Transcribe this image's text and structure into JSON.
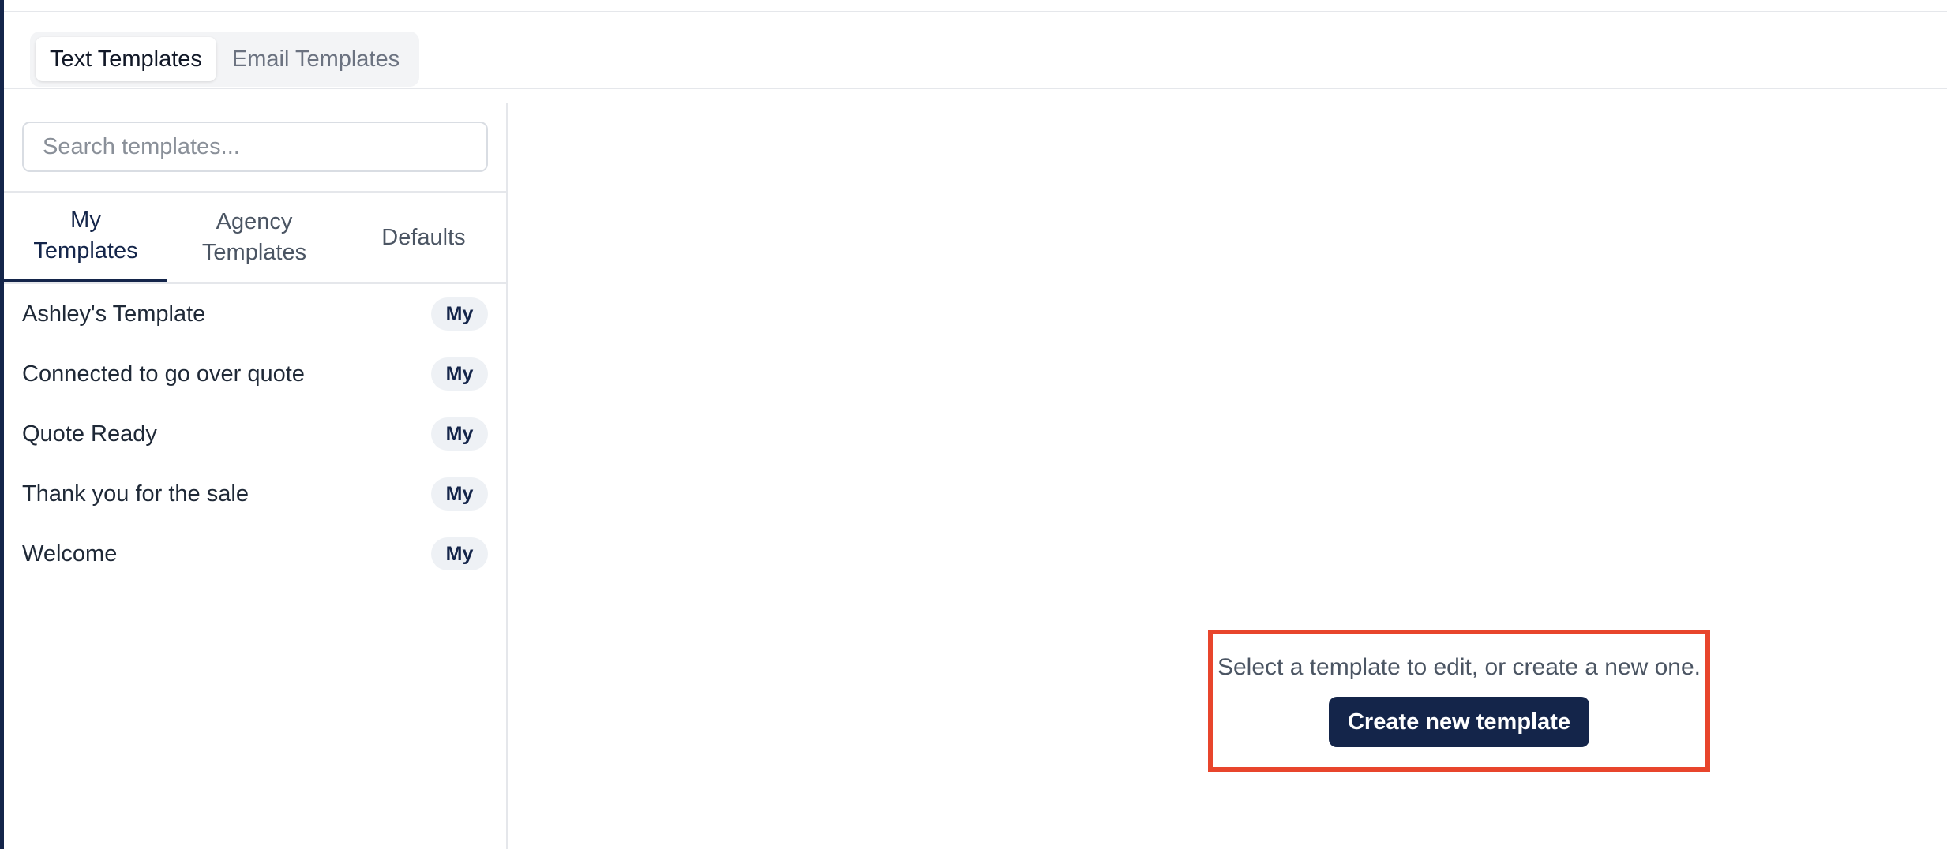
{
  "template_types": {
    "tabs": [
      {
        "label": "Text Templates",
        "active": true
      },
      {
        "label": "Email Templates",
        "active": false
      }
    ]
  },
  "search": {
    "placeholder": "Search templates...",
    "value": ""
  },
  "scope_tabs": {
    "my": {
      "line1": "My",
      "line2": "Templates",
      "active": true
    },
    "agency": {
      "line1": "Agency",
      "line2": "Templates",
      "active": false
    },
    "defaults": {
      "label": "Defaults",
      "active": false
    }
  },
  "templates": [
    {
      "name": "Ashley's Template",
      "badge": "My"
    },
    {
      "name": "Connected to go over quote",
      "badge": "My"
    },
    {
      "name": "Quote Ready",
      "badge": "My"
    },
    {
      "name": "Thank you for the sale",
      "badge": "My"
    },
    {
      "name": "Welcome",
      "badge": "My"
    }
  ],
  "empty_state": {
    "message": "Select a template to edit, or create a new one.",
    "button_label": "Create new template"
  },
  "colors": {
    "brand_navy": "#14254a",
    "highlight_red": "#e8452c",
    "badge_bg": "#eef1f5"
  }
}
